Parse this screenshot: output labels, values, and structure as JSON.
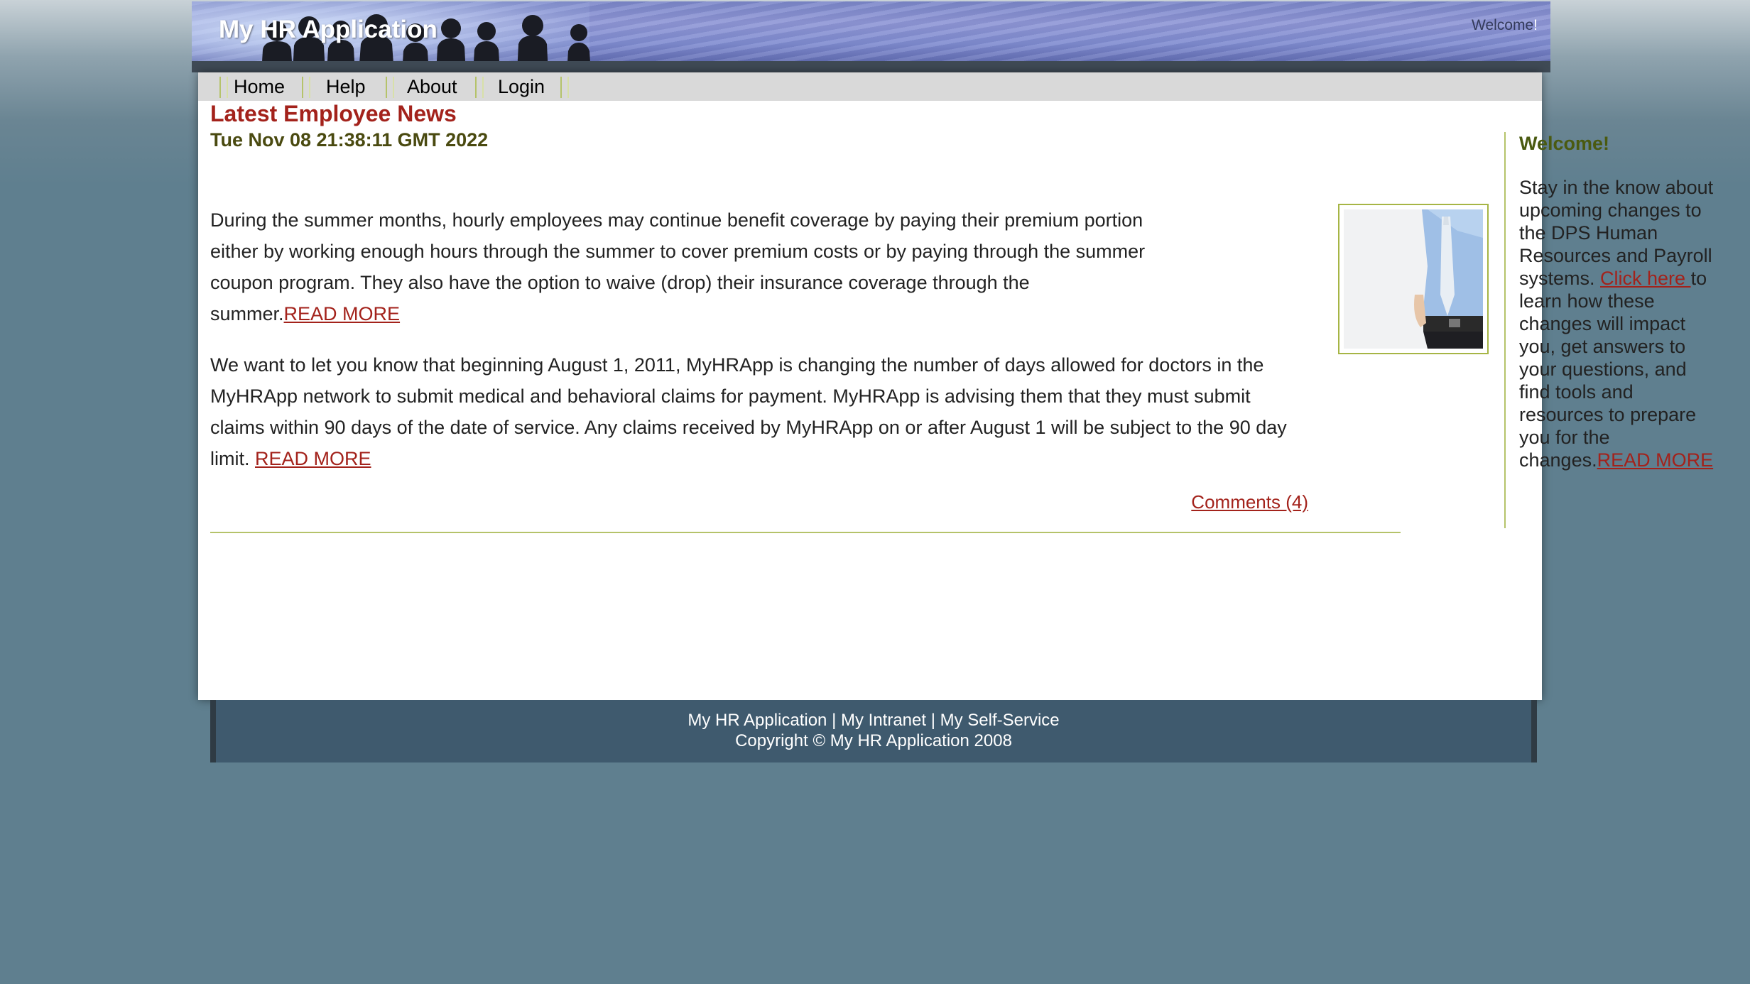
{
  "header": {
    "app_title": "My HR Application",
    "welcome": "Welcome",
    "welcome_excl": "!"
  },
  "nav": {
    "items": [
      {
        "label": "Home"
      },
      {
        "label": "Help"
      },
      {
        "label": "About"
      },
      {
        "label": "Login"
      }
    ]
  },
  "news": {
    "title": "Latest Employee News",
    "date": "Tue Nov 08 21:38:11 GMT 2022",
    "article1_text": "During the summer months, hourly employees may continue benefit coverage by paying their premium portion either by working enough hours through the summer to cover premium costs or by paying through the summer coupon program. They also have the option to waive (drop) their insurance coverage through the summer.",
    "article1_link": "READ MORE",
    "article2_text": "We want to let you know that beginning August 1, 2011, MyHRApp is changing the number of days allowed for doctors in the MyHRApp network to submit medical and behavioral claims for payment.  MyHRApp is advising them that they must submit claims within 90 days of the date of service.  Any claims received by MyHRApp on or after August 1 will be subject to the 90 day limit. ",
    "article2_link": "READ MORE",
    "comments": "Comments (4)"
  },
  "sidebar": {
    "title": "Welcome!",
    "text_before_link": "Stay in the know about upcoming changes to the DPS Human Resources and Payroll systems. ",
    "click_here": "Click here ",
    "text_after_link": "to learn how these changes will impact you, get answers to your questions, and find tools and resources to prepare you for the changes.",
    "read_more": "READ MORE"
  },
  "footer": {
    "link1": "My HR Application",
    "sep": " | ",
    "link2": "My Intranet",
    "link3": "My Self-Service",
    "copyright": "Copyright © My HR Application 2008"
  },
  "colors": {
    "accent_red": "#a3221b",
    "olive": "#4a4a10",
    "divider": "#b5c36a",
    "footer_bg": "#3f5a6e"
  }
}
